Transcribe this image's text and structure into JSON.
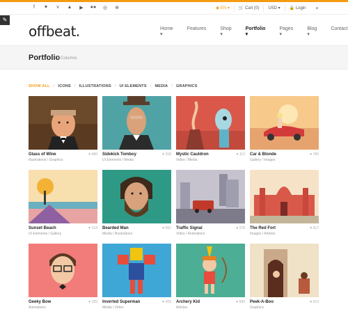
{
  "social_icons": [
    "facebook-icon",
    "twitter-icon",
    "vimeo-icon",
    "pinterest-icon",
    "youtube-icon",
    "flickr-icon",
    "instagram-icon",
    "dribbble-icon"
  ],
  "topbar": {
    "lang": "EN",
    "cart": "Cart (0)",
    "currency": "USD",
    "login": "Login"
  },
  "brand": {
    "logo": "offbeat."
  },
  "nav": [
    "Home",
    "Features",
    "Shop",
    "Portfolio",
    "Pages",
    "Blog",
    "Contact"
  ],
  "page": {
    "title": "Portfolio",
    "subtitle": "4 Columns"
  },
  "filters": [
    "SHOW ALL",
    "ICONS",
    "ILLUSTRATIONS",
    "UI ELEMENTS",
    "MEDIA",
    "GRAPHICS"
  ],
  "items": [
    {
      "title": "Glass of Wine",
      "category": "Illustrations / Graphics",
      "likes": "486"
    },
    {
      "title": "Sidekick Tomboy",
      "category": "UI Elements / Media",
      "likes": "318"
    },
    {
      "title": "Mystic Cauldron",
      "category": "Video / Media",
      "likes": "112"
    },
    {
      "title": "Car & Blonde",
      "category": "Gallery / Images",
      "likes": "780"
    },
    {
      "title": "Sunset Beach",
      "category": "UI Elements / Gallery",
      "likes": "124"
    },
    {
      "title": "Bearded Man",
      "category": "Media / Illustrations",
      "likes": "651"
    },
    {
      "title": "Traffic Signal",
      "category": "Video / Animations",
      "likes": "278"
    },
    {
      "title": "The Red Fort",
      "category": "Images / Articles",
      "likes": "917"
    },
    {
      "title": "Geeky Bow",
      "category": "Animations",
      "likes": "189"
    },
    {
      "title": "Inverted Superman",
      "category": "Media / Video",
      "likes": "205"
    },
    {
      "title": "Archery Kid",
      "category": "Articles",
      "likes": "690"
    },
    {
      "title": "Peek-A-Boo",
      "category": "Graphics",
      "likes": "613"
    }
  ],
  "colors": {
    "accent": "#f39c12"
  }
}
